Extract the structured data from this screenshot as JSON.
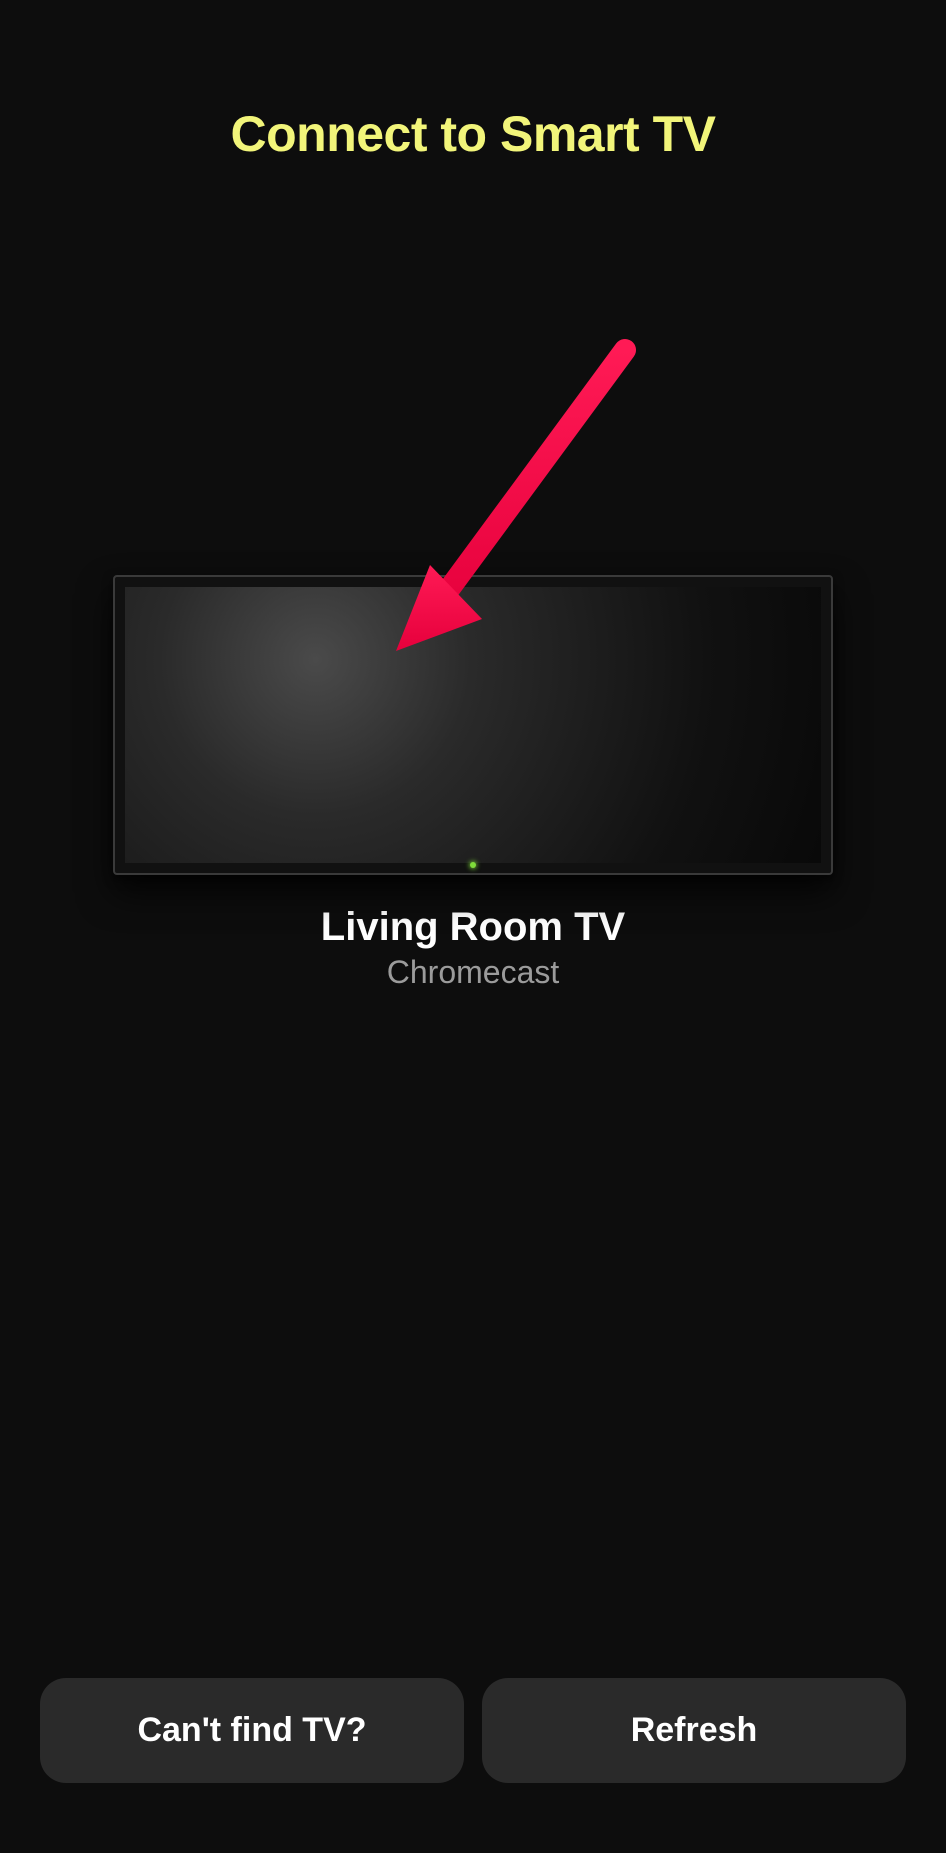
{
  "header": {
    "title": "Connect to Smart TV"
  },
  "device": {
    "name": "Living Room TV",
    "type": "Chromecast"
  },
  "buttons": {
    "cant_find": "Can't find TV?",
    "refresh": "Refresh"
  }
}
